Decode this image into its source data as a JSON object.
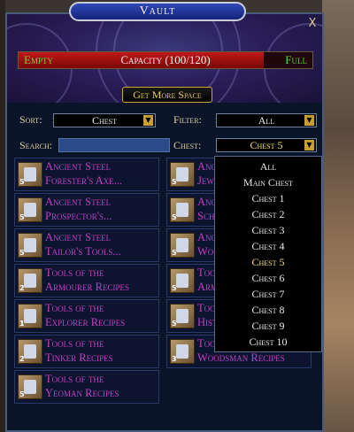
{
  "window": {
    "title": "Vault",
    "close_label": "X"
  },
  "capacity": {
    "empty_label": "Empty",
    "text": "Capacity (100/120)",
    "full_label": "Full",
    "fraction": 0.833
  },
  "get_more_space_label": "Get More Space",
  "sort": {
    "label": "Sort:",
    "value": "Chest"
  },
  "filter": {
    "label": "Filter:",
    "value": "All"
  },
  "search": {
    "label": "Search:",
    "value": ""
  },
  "chest": {
    "label": "Chest:",
    "value": "Chest 5"
  },
  "items_left": [
    {
      "line1": "Ancient Steel",
      "line2": "Forester's Axe...",
      "count": "5"
    },
    {
      "line1": "Ancient Steel",
      "line2": "Prospector's...",
      "count": "5"
    },
    {
      "line1": "Ancient Steel",
      "line2": "Tailor's Tools...",
      "count": "5"
    },
    {
      "line1": "Tools of the",
      "line2": "Armourer Recipes",
      "count": "2"
    },
    {
      "line1": "Tools of the",
      "line2": "Explorer Recipes",
      "count": "1"
    },
    {
      "line1": "Tools of the",
      "line2": "Tinker Recipes",
      "count": "2"
    },
    {
      "line1": "Tools of the",
      "line2": "Yeoman Recipes",
      "count": "5"
    }
  ],
  "items_right": [
    {
      "line1": "Anc",
      "line2": "Jew",
      "count": "5"
    },
    {
      "line1": "Anc",
      "line2": "Scho",
      "count": "5"
    },
    {
      "line1": "Anc",
      "line2": "Wo",
      "count": "5"
    },
    {
      "line1": "Too",
      "line2": "Arm",
      "count": "5"
    },
    {
      "line1": "Too",
      "line2": "Hist",
      "count": "5"
    },
    {
      "line1": "Tools of the",
      "line2": "Woodsman Recipes",
      "count": "3"
    }
  ],
  "chest_dropdown": {
    "options": [
      "All",
      "Main Chest",
      "Chest 1",
      "Chest 2",
      "Chest 3",
      "Chest 4",
      "Chest 5",
      "Chest 6",
      "Chest 7",
      "Chest 8",
      "Chest 9",
      "Chest 10"
    ],
    "selected": "Chest 5"
  },
  "colors": {
    "item_text": "#c040c0",
    "selected_option": "#f0e070",
    "capacity_fill": "#c01818"
  }
}
